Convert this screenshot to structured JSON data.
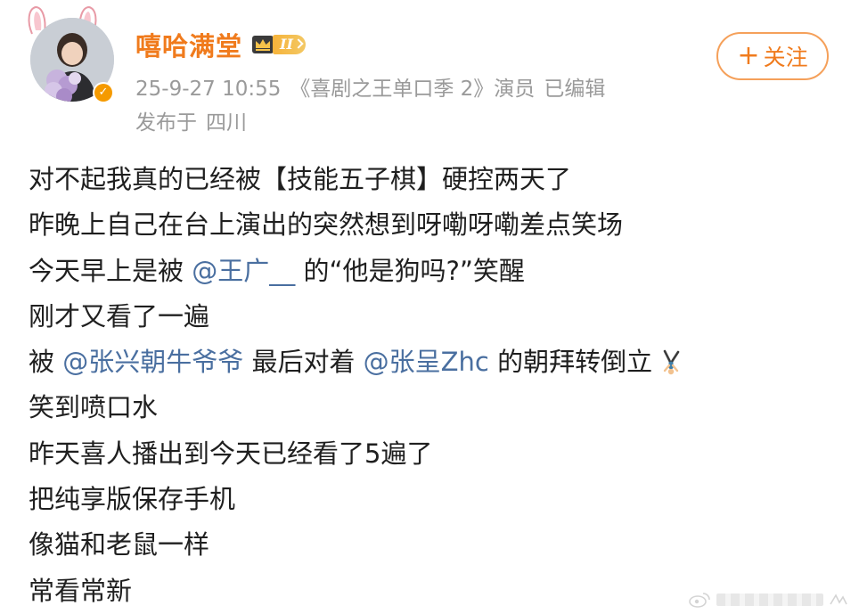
{
  "author": {
    "name": "嘻哈满堂",
    "vip_level": "II",
    "verified": true
  },
  "meta": {
    "timestamp": "25-9-27 10:55",
    "source": "《喜剧之王单口季 2》演员",
    "edited": "已编辑",
    "location_prefix": "发布于",
    "location": "四川"
  },
  "follow_button": {
    "plus": "+",
    "label": "关注"
  },
  "post": {
    "line1": "对不起我真的已经被【技能五子棋】硬控两天了",
    "line2": "昨晚上自己在台上演出的突然想到呀嘞呀嘞差点笑场",
    "line3": {
      "pre": "今天早上是被 ",
      "mention": "@王广__",
      "post": " 的“他是狗吗?”笑醒"
    },
    "line4": "刚才又看了一遍",
    "line5": {
      "pre": "被 ",
      "mention1": "@张兴朝牛爷爷",
      "mid": " 最后对着 ",
      "mention2": "@张呈Zhc",
      "post": " 的朝拜转倒立",
      "emoji": "handstand-emoji"
    },
    "line6": "笑到喷口水",
    "line7": "昨天喜人播出到今天已经看了5遍了",
    "line8": "把纯享版保存手机",
    "line9": "像猫和老鼠一样",
    "line10": "常看常新"
  },
  "colors": {
    "username": "#f07b1d",
    "mention": "#4a6fa0",
    "meta": "#9a9a9a",
    "follow_border": "#f5a05a",
    "verified": "#f59a00"
  },
  "icons": {
    "ears": "bunny-ears-icon",
    "crown": "crown-icon",
    "verified": "verified-v-icon",
    "watermark": "weibo-watermark-icon"
  }
}
